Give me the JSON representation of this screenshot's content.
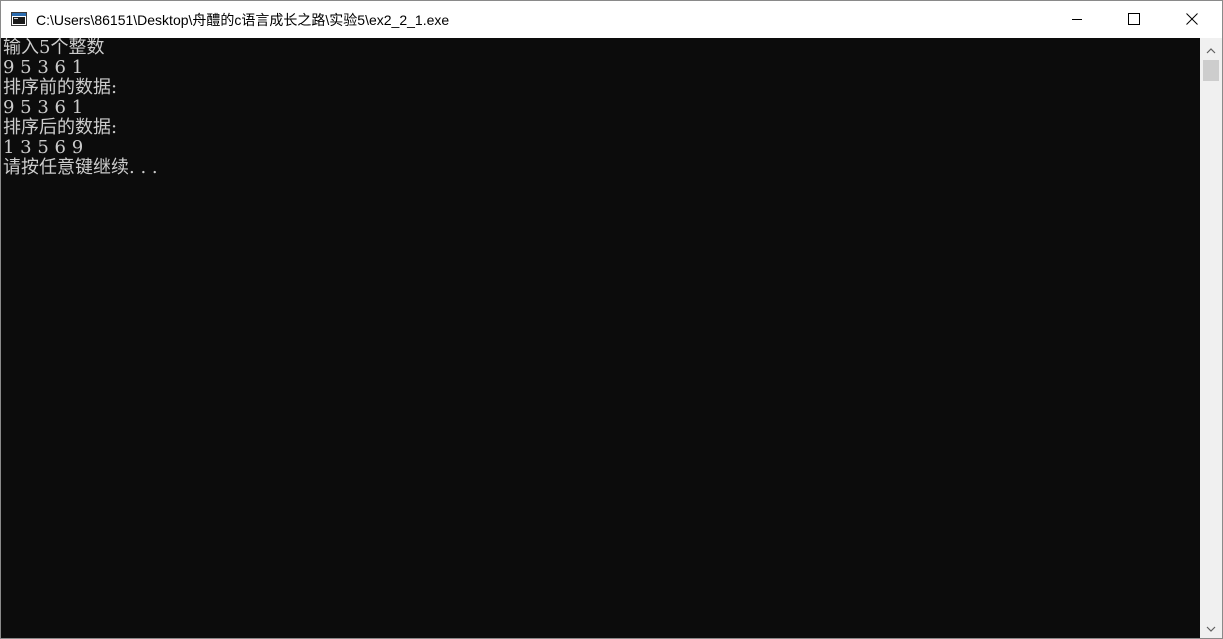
{
  "window": {
    "title": "C:\\Users\\86151\\Desktop\\舟醴的c语言成长之路\\实验5\\ex2_2_1.exe",
    "icon": "console-app-icon",
    "controls": [
      "minimize-icon",
      "maximize-icon",
      "close-icon"
    ]
  },
  "console": {
    "lines": [
      "输入5个整数",
      "9 5 3 6 1",
      "排序前的数据:",
      "9 5 3 6 1",
      "排序后的数据:",
      "1 3 5 6 9",
      "请按任意键继续. . ."
    ],
    "text_color": "#cccccc",
    "background": "#0c0c0c"
  }
}
